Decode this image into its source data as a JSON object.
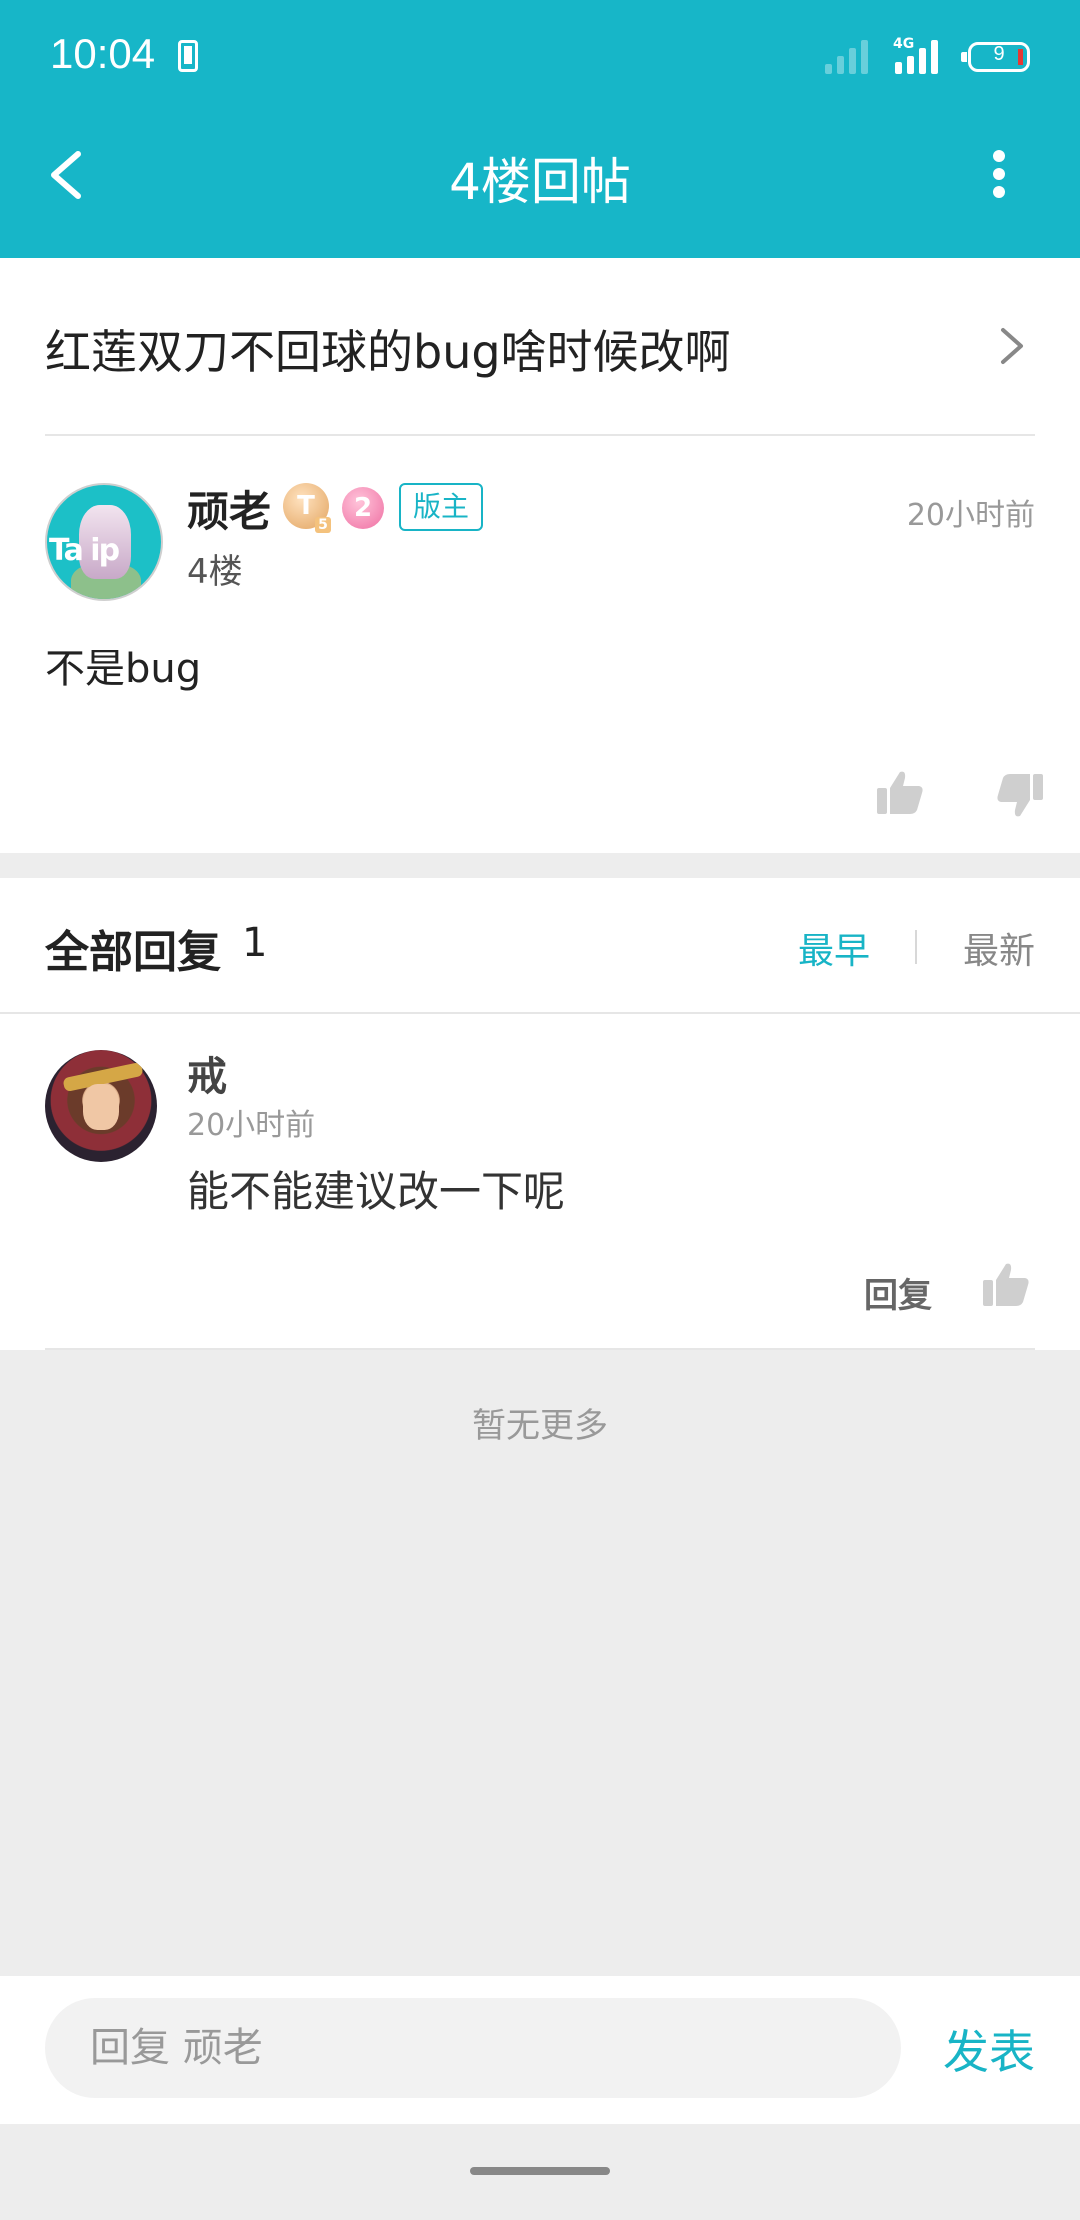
{
  "status_bar": {
    "time": "10:04",
    "network_label": "4G",
    "battery_level": "9"
  },
  "header": {
    "title": "4楼回帖",
    "back_icon": "chevron-left-icon",
    "more_icon": "more-vertical-icon"
  },
  "thread": {
    "title": "红莲双刀不回球的bug啥时候改啊"
  },
  "post": {
    "author": "顽老",
    "badge_t": "T",
    "badge_t_level": "5",
    "badge_level": "2",
    "role_badge": "版主",
    "floor": "4楼",
    "time": "20小时前",
    "content": "不是bug",
    "avatar_text": "Ta  ip"
  },
  "replies": {
    "title": "全部回复",
    "count": "1",
    "sort_earliest": "最早",
    "sort_latest": "最新",
    "items": [
      {
        "author": "戒",
        "time": "20小时前",
        "content": "能不能建议改一下呢",
        "reply_label": "回复"
      }
    ],
    "end_text": "暂无更多"
  },
  "input_bar": {
    "placeholder": "回复 顽老",
    "publish_label": "发表"
  },
  "colors": {
    "accent": "#17b6c8",
    "background": "#ededed"
  }
}
